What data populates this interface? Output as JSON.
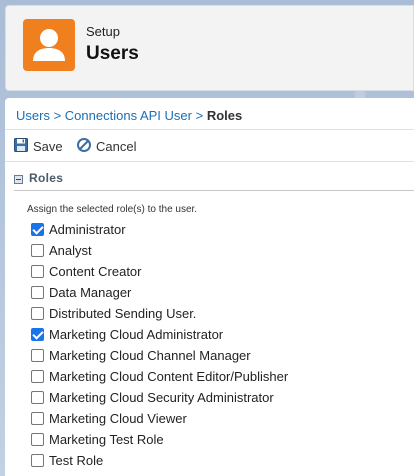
{
  "header": {
    "eyebrow": "Setup",
    "title": "Users",
    "icon": "user-icon",
    "icon_color": "#f07f1d"
  },
  "breadcrumb": {
    "items": [
      "Users",
      "Connections API User"
    ],
    "separator": ">",
    "current": "Roles"
  },
  "toolbar": {
    "save_label": "Save",
    "cancel_label": "Cancel"
  },
  "section": {
    "title": "Roles",
    "instructions": "Assign the selected role(s) to the user."
  },
  "roles": [
    {
      "label": "Administrator",
      "checked": true
    },
    {
      "label": "Analyst",
      "checked": false
    },
    {
      "label": "Content Creator",
      "checked": false
    },
    {
      "label": "Data Manager",
      "checked": false
    },
    {
      "label": "Distributed Sending User.",
      "checked": false
    },
    {
      "label": "Marketing Cloud Administrator",
      "checked": true
    },
    {
      "label": "Marketing Cloud Channel Manager",
      "checked": false
    },
    {
      "label": "Marketing Cloud Content Editor/Publisher",
      "checked": false
    },
    {
      "label": "Marketing Cloud Security Administrator",
      "checked": false
    },
    {
      "label": "Marketing Cloud Viewer",
      "checked": false
    },
    {
      "label": "Marketing Test Role",
      "checked": false
    },
    {
      "label": "Test Role",
      "checked": false
    }
  ],
  "colors": {
    "link": "#1a6fb5",
    "checkbox_checked": "#1a73e8"
  }
}
